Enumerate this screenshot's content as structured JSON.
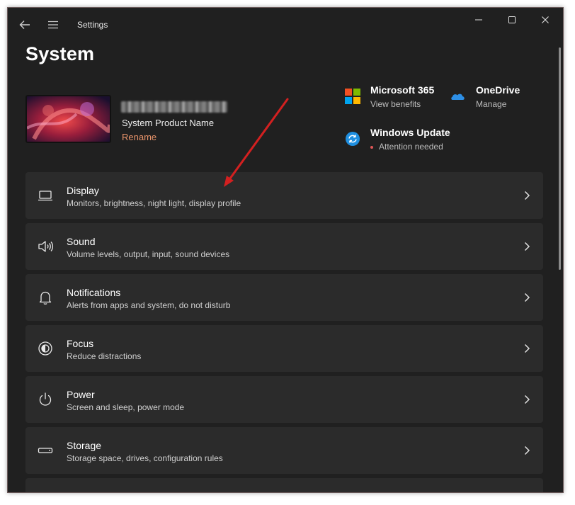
{
  "titlebar": {
    "back_icon": "back-arrow-icon",
    "menu_icon": "hamburger-menu-icon",
    "app_title": "Settings",
    "controls": [
      "minimize-icon",
      "maximize-icon",
      "close-icon"
    ]
  },
  "page": {
    "title": "System"
  },
  "device": {
    "model": "System Product Name",
    "rename_label": "Rename"
  },
  "services": {
    "m365": {
      "title": "Microsoft 365",
      "subtitle": "View benefits",
      "icon": "microsoft-logo-icon"
    },
    "onedrive": {
      "title": "OneDrive",
      "subtitle": "Manage",
      "icon": "onedrive-cloud-icon"
    },
    "update": {
      "title": "Windows Update",
      "subtitle": "Attention needed",
      "icon": "windows-update-icon",
      "status_color": "#e05656"
    }
  },
  "cards": [
    {
      "title": "Display",
      "subtitle": "Monitors, brightness, night light, display profile",
      "icon": "display-laptop-icon"
    },
    {
      "title": "Sound",
      "subtitle": "Volume levels, output, input, sound devices",
      "icon": "speaker-icon"
    },
    {
      "title": "Notifications",
      "subtitle": "Alerts from apps and system, do not disturb",
      "icon": "bell-icon"
    },
    {
      "title": "Focus",
      "subtitle": "Reduce distractions",
      "icon": "focus-icon"
    },
    {
      "title": "Power",
      "subtitle": "Screen and sleep, power mode",
      "icon": "power-icon"
    },
    {
      "title": "Storage",
      "subtitle": "Storage space, drives, configuration rules",
      "icon": "storage-drive-icon"
    }
  ],
  "colors": {
    "window_bg": "#202020",
    "card_bg": "#2b2b2b",
    "accent_link": "#e8936a",
    "annotation_arrow": "#d32020"
  }
}
